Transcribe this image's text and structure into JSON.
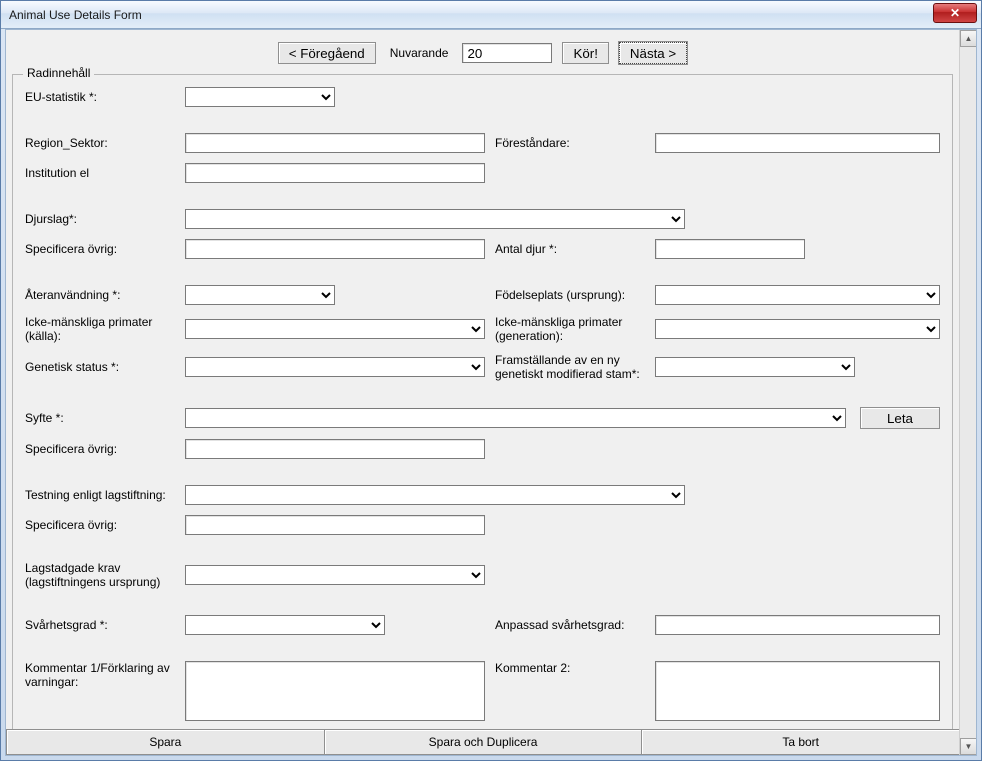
{
  "window": {
    "title": "Animal Use Details Form"
  },
  "nav": {
    "prev_label": "< Föregåend",
    "current_label": "Nuvarande",
    "current_value": "20",
    "go_label": "Kör!",
    "next_label": "Nästa  >"
  },
  "fieldset": {
    "legend": "Radinnehåll"
  },
  "labels": {
    "eu_stats": "EU-statistik *:",
    "region_sektor": "Region_Sektor:",
    "forestandare": "Föreståndare:",
    "institution": "Institution el",
    "djurslag": "Djurslag*:",
    "spec_ovrig": "Specificera övrig:",
    "antal_djur": "Antal djur *:",
    "ateranvandning": "Återanvändning *:",
    "fodelseplats": "Födelseplats (ursprung):",
    "primater_kalla": "Icke-mänskliga primater (källa):",
    "primater_gen": "Icke-mänskliga primater (generation):",
    "genetisk_status": "Genetisk status *:",
    "framstallande": "Framställande av en ny genetiskt modifierad stam*:",
    "syfte": "Syfte *:",
    "leta": "Leta",
    "spec_ovrig2": "Specificera övrig:",
    "testning": "Testning enligt lagstiftning:",
    "spec_ovrig3": "Specificera övrig:",
    "lagstadgade": "Lagstadgade krav (lagstiftningens ursprung)",
    "svarhetsgrad": "Svårhetsgrad *:",
    "anpassad_svar": "Anpassad svårhetsgrad:",
    "kommentar1": "Kommentar 1/Förklaring av varningar:",
    "kommentar2": "Kommentar 2:"
  },
  "values": {
    "eu_stats": "",
    "region_sektor": "",
    "forestandare": "",
    "institution": "",
    "djurslag": "",
    "spec_ovrig": "",
    "antal_djur": "",
    "ateranvandning": "",
    "fodelseplats": "",
    "primater_kalla": "",
    "primater_gen": "",
    "genetisk_status": "",
    "framstallande": "",
    "syfte": "",
    "spec_ovrig2": "",
    "testning": "",
    "spec_ovrig3": "",
    "lagstadgade": "",
    "svarhetsgrad": "",
    "anpassad_svar": "",
    "kommentar1": "",
    "kommentar2": ""
  },
  "bottom": {
    "save": "Spara",
    "save_dup": "Spara och Duplicera",
    "delete": "Ta bort"
  }
}
